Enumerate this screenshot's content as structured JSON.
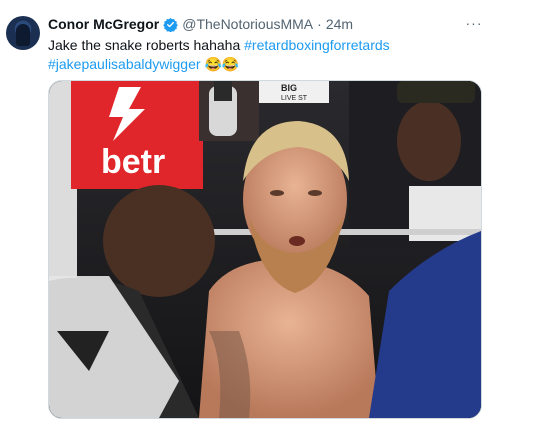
{
  "tweet": {
    "author_name": "Conor McGregor",
    "handle": "@TheNotoriousMMA",
    "separator": "·",
    "time": "24m",
    "more_label": "···",
    "text_plain": "Jake the snake roberts hahaha ",
    "hashtag_1": "#retardboxingforretards",
    "hashtag_2": "#jakepaulisabaldywigger",
    "emojis": "😂😂"
  },
  "media": {
    "sign_text": "betr",
    "banner_text": "LIVE ST",
    "banner_text_2": "BIG"
  },
  "icons": {
    "verified": "verified-badge-icon",
    "more": "more-options-icon"
  },
  "colors": {
    "hashtag": "#1d9bf0",
    "verified": "#1d9bf0",
    "sign_red": "#e1262b"
  }
}
